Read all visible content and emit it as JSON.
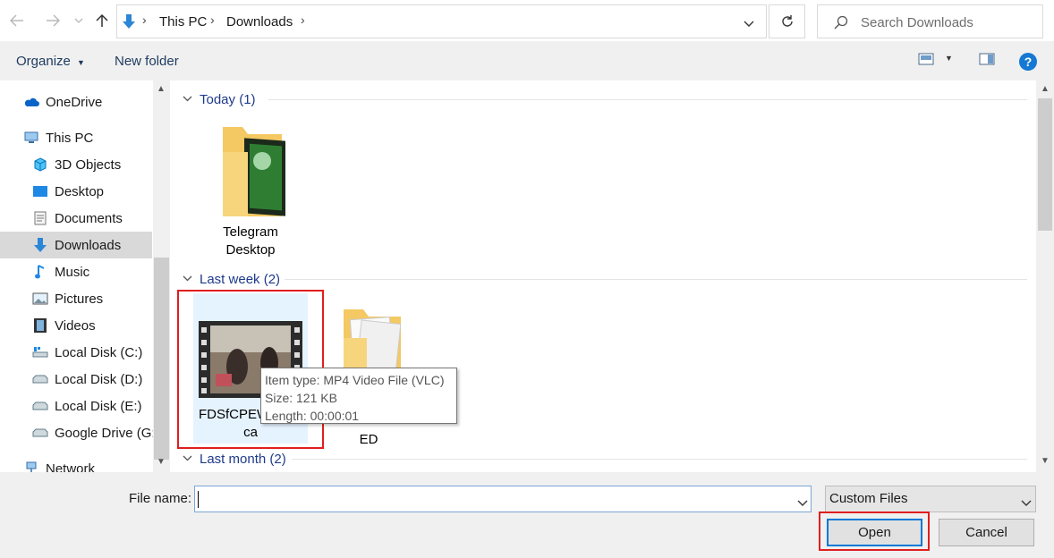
{
  "address_bar": {
    "breadcrumbs": [
      "This PC",
      "Downloads"
    ],
    "search_placeholder": "Search Downloads"
  },
  "toolbar": {
    "organize_label": "Organize",
    "new_folder_label": "New folder",
    "help_glyph": "?"
  },
  "sidebar": {
    "items": [
      {
        "label": "OneDrive",
        "icon": "cloud-icon"
      },
      {
        "label": "This PC",
        "icon": "computer-icon"
      },
      {
        "label": "3D Objects",
        "icon": "cube-icon"
      },
      {
        "label": "Desktop",
        "icon": "desktop-icon"
      },
      {
        "label": "Documents",
        "icon": "document-icon"
      },
      {
        "label": "Downloads",
        "icon": "download-arrow-icon",
        "selected": true
      },
      {
        "label": "Music",
        "icon": "music-note-icon"
      },
      {
        "label": "Pictures",
        "icon": "picture-icon"
      },
      {
        "label": "Videos",
        "icon": "film-icon"
      },
      {
        "label": "Local Disk (C:)",
        "icon": "drive-windows-icon"
      },
      {
        "label": "Local Disk (D:)",
        "icon": "drive-icon"
      },
      {
        "label": "Local Disk (E:)",
        "icon": "drive-icon"
      },
      {
        "label": "Google Drive (G:",
        "icon": "drive-icon"
      },
      {
        "label": "Network",
        "icon": "network-icon"
      }
    ]
  },
  "groups": [
    {
      "header": "Today (1)"
    },
    {
      "header": "Last week (2)"
    },
    {
      "header": "Last month (2)"
    }
  ],
  "tiles": {
    "telegram_line1": "Telegram",
    "telegram_line2": "Desktop",
    "video_line1": "FDSfCPEW",
    "video_line2": "ca",
    "folder2_label": "ED"
  },
  "tooltip": {
    "line1": "Item type: MP4 Video File (VLC)",
    "line2": "Size: 121 KB",
    "line3": "Length: 00:00:01"
  },
  "bottom": {
    "file_name_label": "File name:",
    "file_name_value": "",
    "file_type_value": "Custom Files",
    "open_label": "Open",
    "cancel_label": "Cancel"
  },
  "colors": {
    "accent": "#0078d7",
    "highlight_box": "#e01e1e",
    "group_header": "#1e3a8a"
  }
}
